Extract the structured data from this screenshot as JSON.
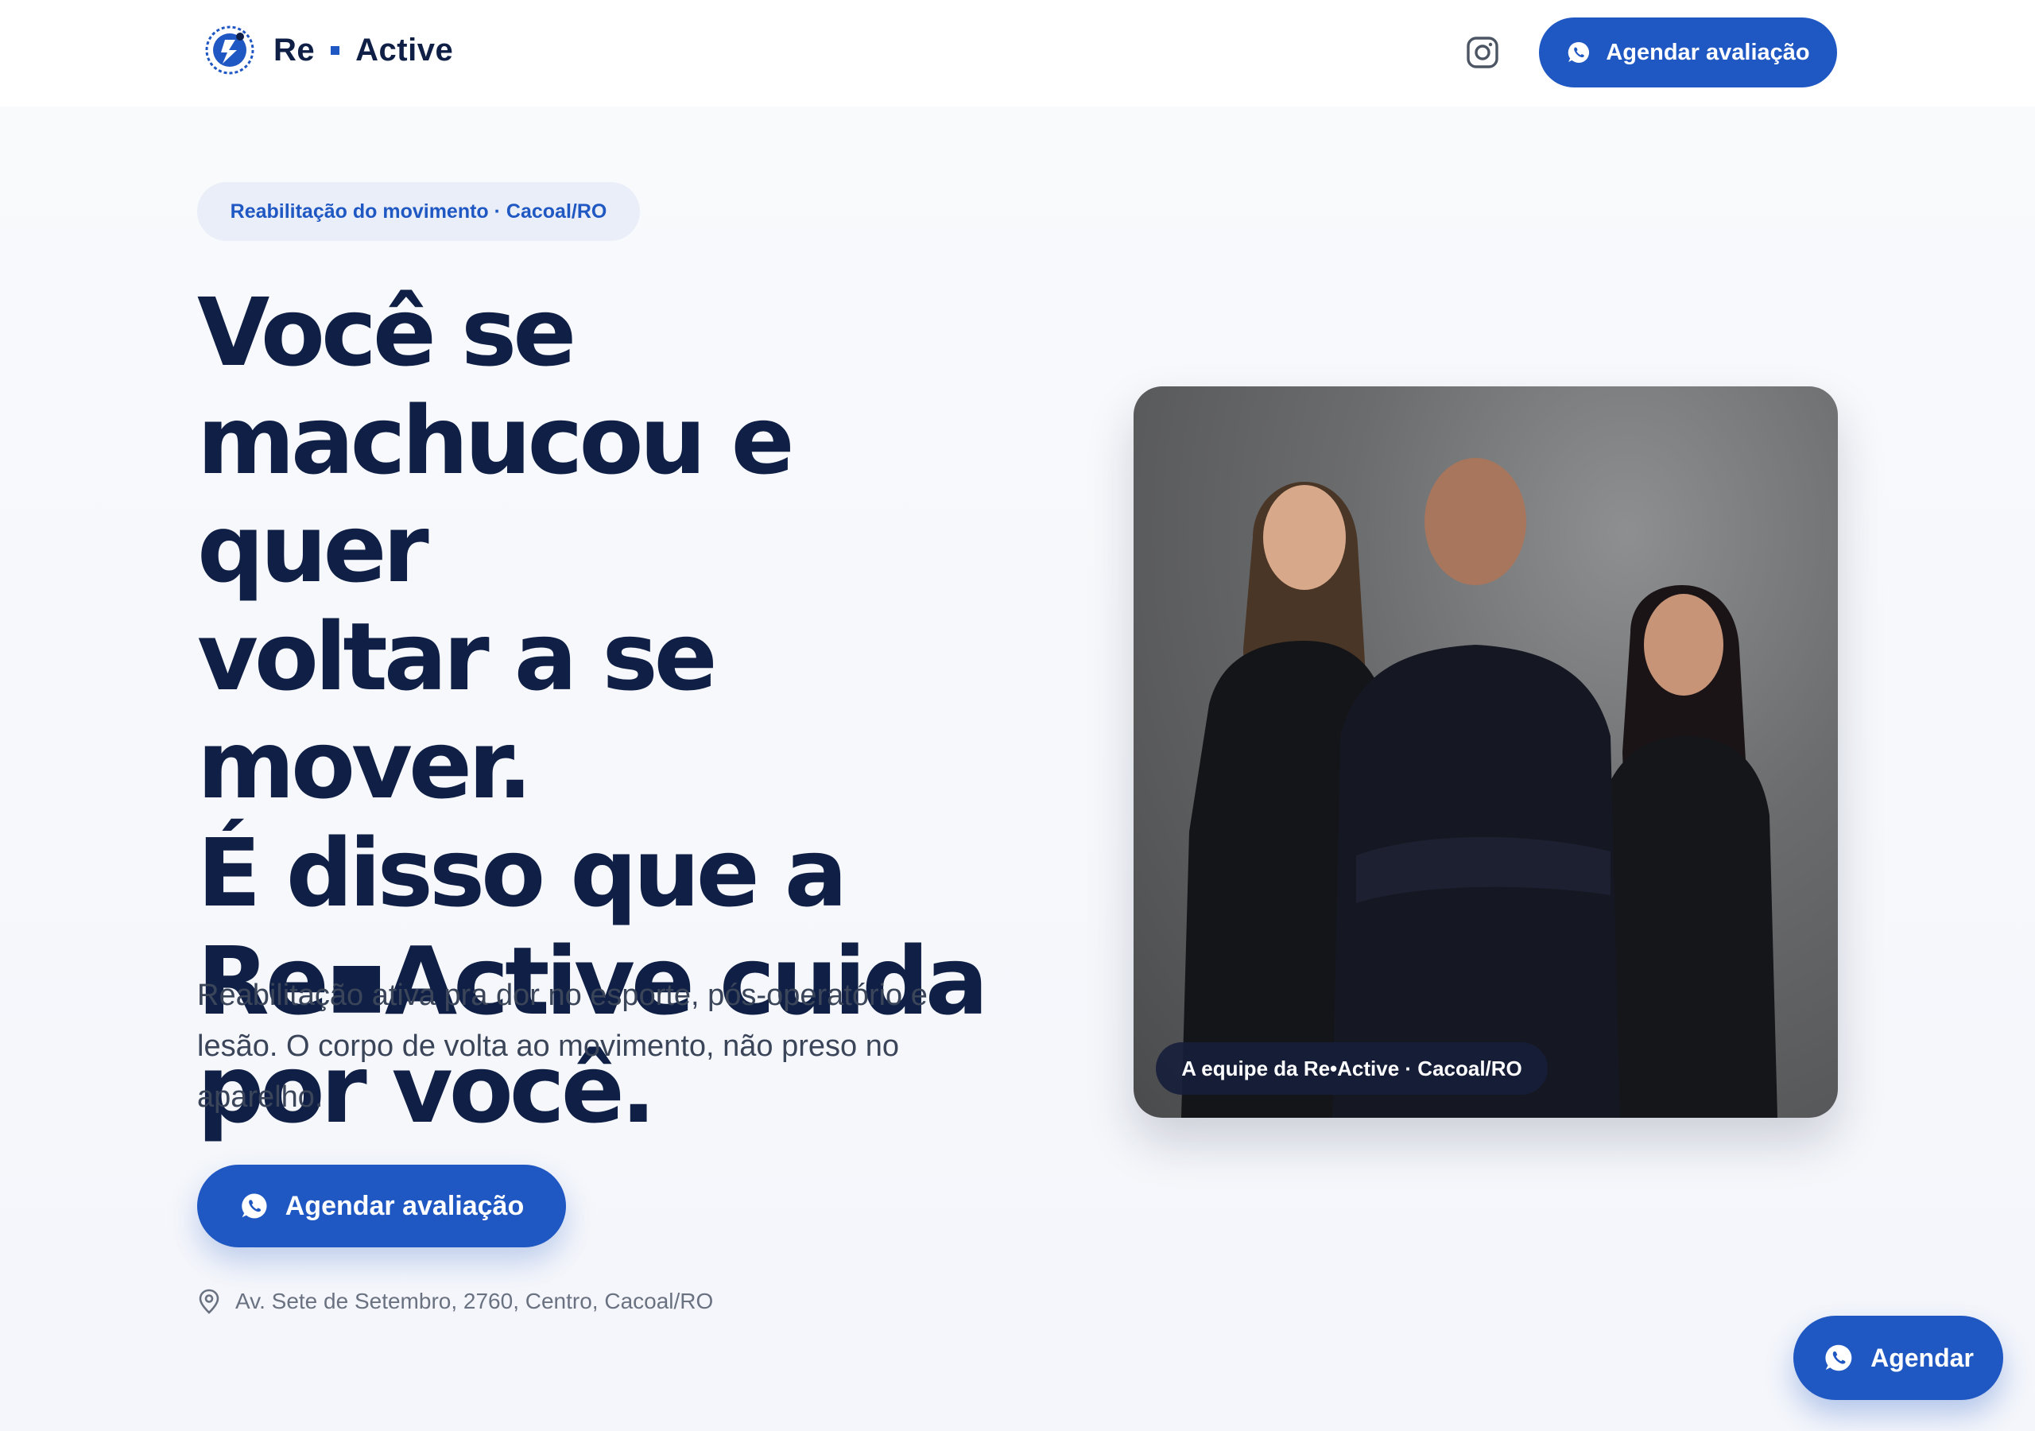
{
  "header": {
    "logo_left": "Re",
    "logo_right": "Active",
    "cta_label": "Agendar avaliação"
  },
  "hero": {
    "tag": "Reabilitação do movimento · Cacoal/RO",
    "headline_lines": [
      "Você se",
      "machucou e quer",
      "voltar a se mover.",
      "É disso que a",
      "Re▪Active cuida",
      "por você."
    ],
    "lead": "Reabilitação ativa pra dor no esporte, pós-operatório e lesão. O corpo de volta ao movimento, não preso no aparelho.",
    "cta_label": "Agendar avaliação",
    "address": "Av. Sete de Setembro, 2760, Centro, Cacoal/RO"
  },
  "photo": {
    "caption": "A equipe da Re•Active · Cacoal/RO"
  },
  "floating": {
    "cta_label": "Agendar"
  },
  "colors": {
    "brand_blue": "#1f57c3",
    "navy": "#0f1f45",
    "pill_bg": "#e9eef8"
  },
  "icons": [
    "logo-runner-icon",
    "instagram-icon",
    "whatsapp-icon",
    "location-pin-icon"
  ]
}
